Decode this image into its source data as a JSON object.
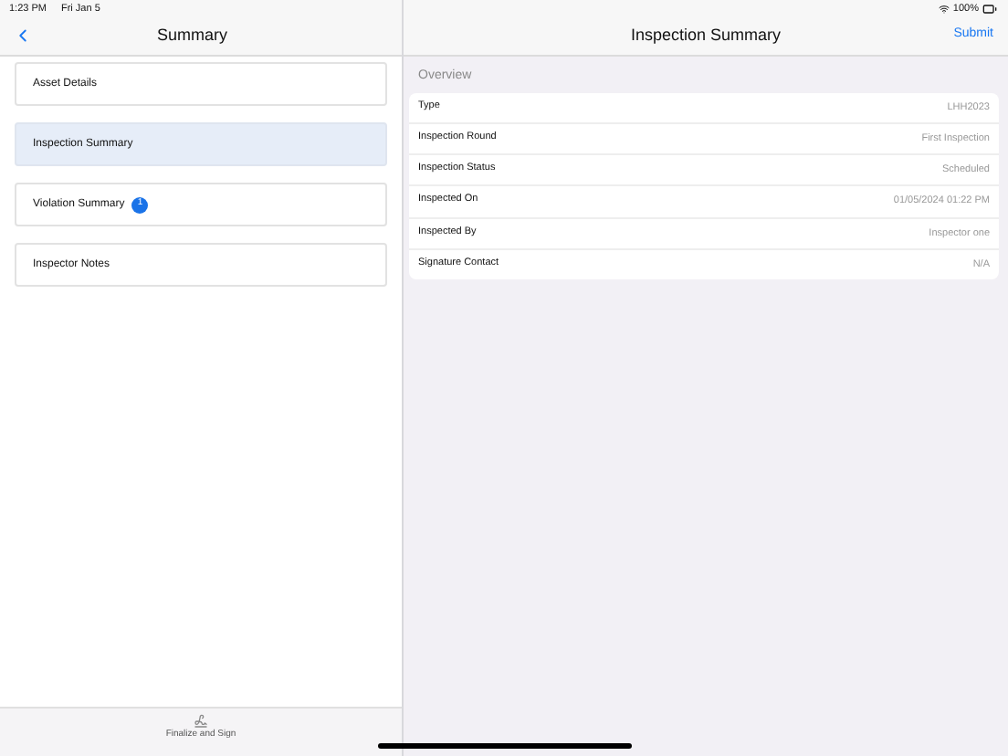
{
  "status_bar": {
    "time": "1:23 PM",
    "date": "Fri Jan 5",
    "battery": "100%"
  },
  "sidebar": {
    "title": "Summary",
    "items": [
      {
        "label": "Asset Details",
        "selected": false
      },
      {
        "label": "Inspection Summary",
        "selected": true
      },
      {
        "label": "Violation Summary",
        "selected": false,
        "badge": "1"
      },
      {
        "label": "Inspector Notes",
        "selected": false
      }
    ],
    "footer_button": "Finalize and Sign"
  },
  "detail": {
    "title": "Inspection Summary",
    "action": "Submit",
    "section": "Overview",
    "rows": [
      {
        "label": "Type",
        "value": "LHH2023"
      },
      {
        "label": "Inspection Round",
        "value": "First Inspection"
      },
      {
        "label": "Inspection Status",
        "value": "Scheduled"
      },
      {
        "label": "Inspected On",
        "value": "01/05/2024 01:22 PM"
      },
      {
        "label": "Inspected By",
        "value": "Inspector one"
      },
      {
        "label": "Signature Contact",
        "value": "N/A"
      }
    ]
  }
}
